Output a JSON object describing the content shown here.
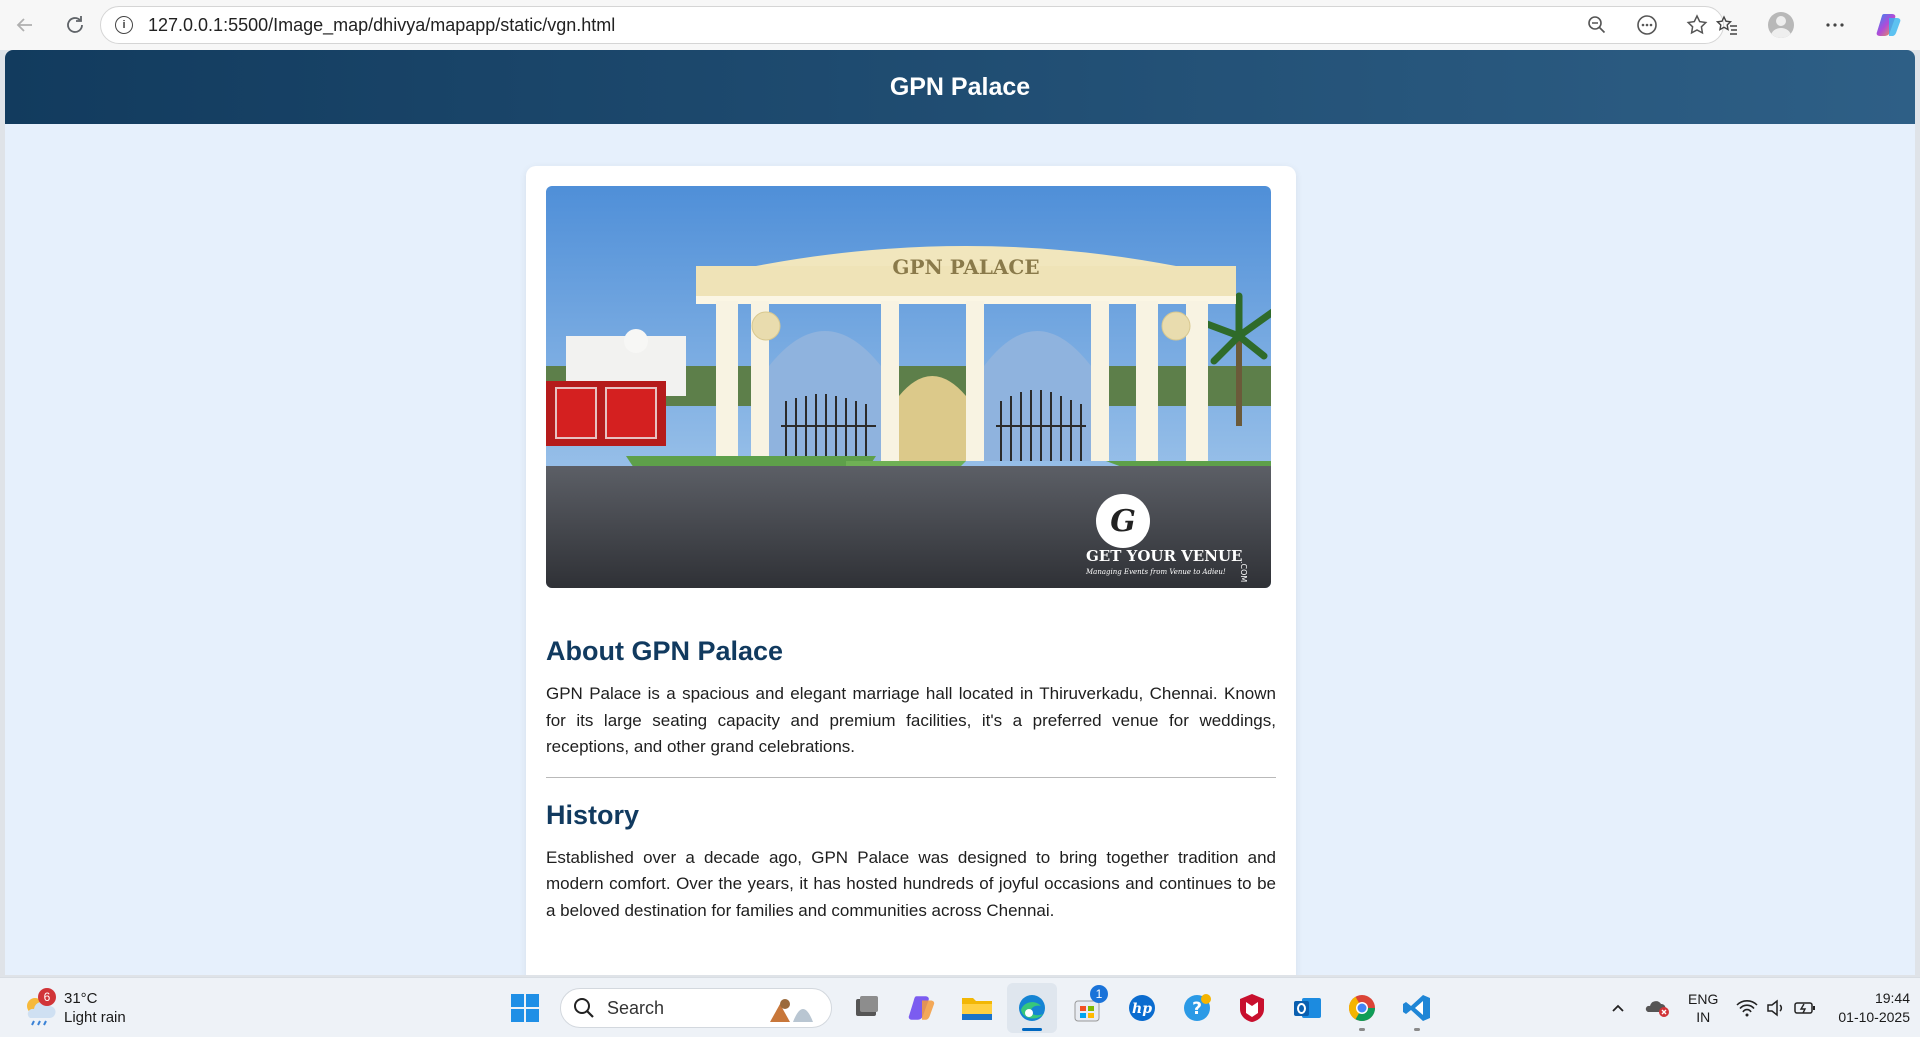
{
  "browser": {
    "url": "127.0.0.1:5500/Image_map/dhivya/mapapp/static/vgn.html"
  },
  "page": {
    "header_title": "GPN Palace",
    "hero": {
      "sign_text": "GPN PALACE",
      "watermark_line1": "GET YOUR VENUE",
      "watermark_line2": "Managing Events from Venue to Adieu!",
      "watermark_suffix": ".COM"
    },
    "about": {
      "title": "About GPN Palace",
      "text": "GPN Palace is a spacious and elegant marriage hall located in Thiruverkadu, Chennai. Known for its large seating capacity and premium facilities, it's a preferred venue for weddings, receptions, and other grand celebrations."
    },
    "history": {
      "title": "History",
      "text": "Established over a decade ago, GPN Palace was designed to bring together tradition and modern comfort. Over the years, it has hosted hundreds of joyful occasions and continues to be a beloved destination for families and communities across Chennai."
    }
  },
  "taskbar": {
    "weather": {
      "badge": "6",
      "temp": "31°C",
      "condition": "Light rain"
    },
    "search_label": "Search",
    "store_badge": "1",
    "tray": {
      "lang_line1": "ENG",
      "lang_line2": "IN",
      "time": "19:44",
      "date": "01-10-2025"
    }
  },
  "colors": {
    "header_gradient_start": "#123b5e",
    "header_gradient_end": "#2e5f86",
    "page_background": "#e6f0fc",
    "heading_color": "#113a5f"
  }
}
